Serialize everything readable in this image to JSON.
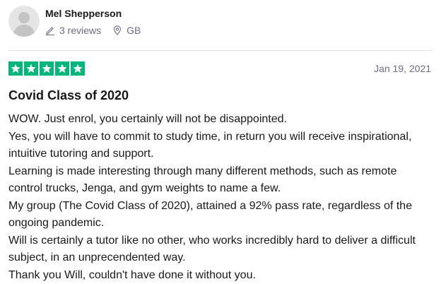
{
  "reviewer": {
    "name": "Mel Shepperson",
    "reviews": "3 reviews",
    "country": "GB"
  },
  "review": {
    "rating": 5,
    "max_rating": 5,
    "date": "Jan 19, 2021",
    "title": "Covid Class of 2020",
    "paragraphs": [
      "WOW. Just enrol, you certainly will not be disappointed.",
      "Yes, you will have to commit to study time, in return you will receive inspirational, intuitive tutoring and support.",
      "Learning is made interesting through many different methods, such as remote control trucks, Jenga, and gym weights to name a few.",
      "My group (The Covid Class of 2020), attained a 92% pass rate, regardless of the ongoing pandemic.",
      "Will is certainly a tutor like no other, who works incredibly hard to deliver a difficult subject, in an unprecendented way.",
      "Thank you Will, couldn't have done it without you."
    ]
  },
  "colors": {
    "star_green": "#00b67a",
    "muted_text": "#6c6c85"
  },
  "icons": {
    "reviews": "pencil-icon",
    "location": "location-pin-icon",
    "rating": "star-icon"
  }
}
